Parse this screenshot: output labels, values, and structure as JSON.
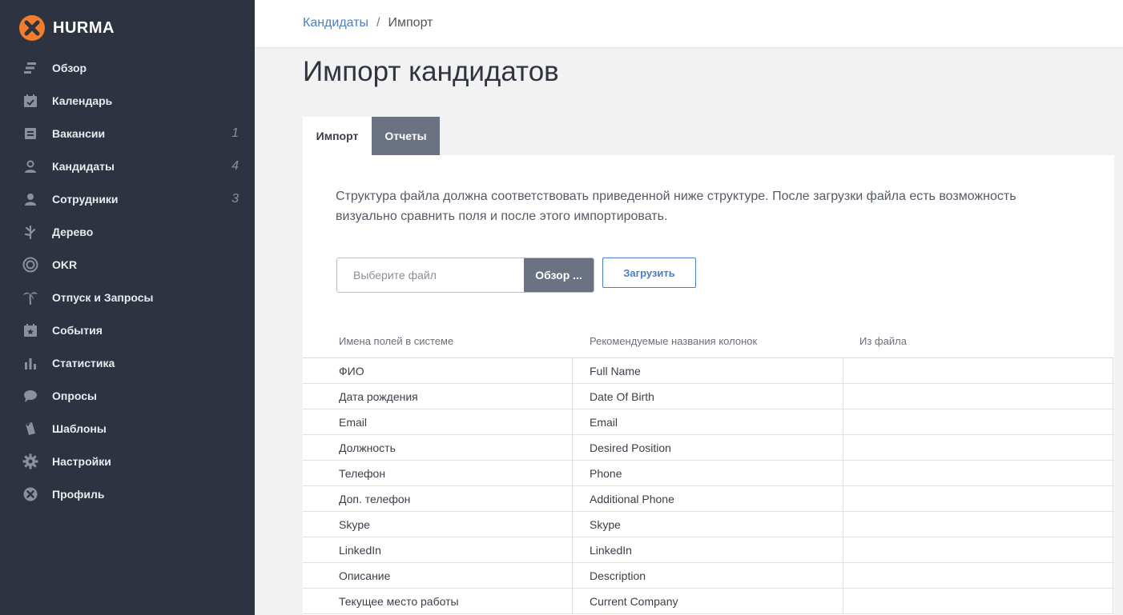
{
  "app": {
    "name": "HURMA",
    "brand_color": "#f47d2c"
  },
  "sidebar": {
    "items": [
      {
        "label": "Обзор",
        "icon": "overview-icon",
        "badge": ""
      },
      {
        "label": "Календарь",
        "icon": "calendar-icon",
        "badge": ""
      },
      {
        "label": "Вакансии",
        "icon": "vacancies-icon",
        "badge": "1"
      },
      {
        "label": "Кандидаты",
        "icon": "candidates-icon",
        "badge": "4"
      },
      {
        "label": "Сотрудники",
        "icon": "employees-icon",
        "badge": "3"
      },
      {
        "label": "Дерево",
        "icon": "tree-icon",
        "badge": ""
      },
      {
        "label": "OKR",
        "icon": "target-icon",
        "badge": ""
      },
      {
        "label": "Отпуск и Запросы",
        "icon": "palm-icon",
        "badge": ""
      },
      {
        "label": "События",
        "icon": "events-icon",
        "badge": ""
      },
      {
        "label": "Статистика",
        "icon": "statistics-icon",
        "badge": ""
      },
      {
        "label": "Опросы",
        "icon": "chat-bubble-icon",
        "badge": ""
      },
      {
        "label": "Шаблоны",
        "icon": "templates-icon",
        "badge": ""
      },
      {
        "label": "Настройки",
        "icon": "gear-icon",
        "badge": ""
      },
      {
        "label": "Профиль",
        "icon": "profile-icon",
        "badge": ""
      }
    ]
  },
  "header": {
    "breadcrumb": {
      "parent": "Кандидаты",
      "separator": "/",
      "current": "Импорт"
    }
  },
  "page": {
    "title": "Импорт кандидатов",
    "tabs": [
      {
        "label": "Импорт",
        "active": true
      },
      {
        "label": "Отчеты",
        "active": false
      }
    ],
    "description": "Структура файла должна соответствовать приведенной ниже структуре. После загрузки файла есть возможность визуально сравнить поля и после этого импортировать.",
    "file_input": {
      "placeholder": "Выберите файл",
      "value": ""
    },
    "browse_label": "Обзор ...",
    "upload_label": "Загрузить"
  },
  "table": {
    "headers": [
      "Имена полей в системе",
      "Рекомендуемые названия колонок",
      "Из файла"
    ],
    "rows": [
      [
        "ФИО",
        "Full Name",
        ""
      ],
      [
        "Дата рождения",
        "Date Of Birth",
        ""
      ],
      [
        "Email",
        "Email",
        ""
      ],
      [
        "Должность",
        "Desired Position",
        ""
      ],
      [
        "Телефон",
        "Phone",
        ""
      ],
      [
        "Доп. телефон",
        "Additional Phone",
        ""
      ],
      [
        "Skype",
        "Skype",
        ""
      ],
      [
        "LinkedIn",
        "LinkedIn",
        ""
      ],
      [
        "Описание",
        "Description",
        ""
      ],
      [
        "Текущее место работы",
        "Current Company",
        ""
      ]
    ]
  }
}
